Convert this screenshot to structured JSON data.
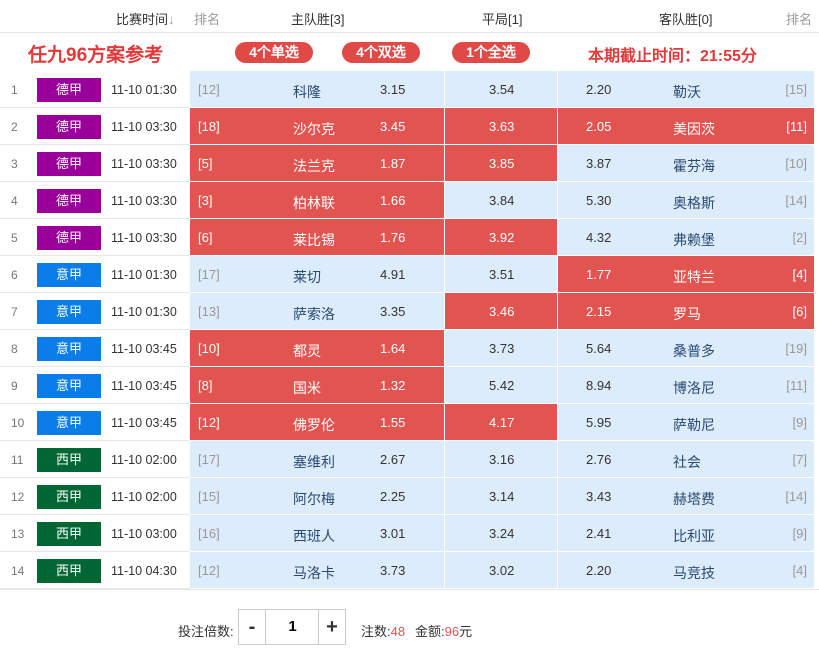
{
  "header": {
    "time_col": "比赛时间",
    "time_sort_icon": "arrow-down-icon",
    "rank_left": "排名",
    "home_win": "主队胜[3]",
    "draw": "平局[1]",
    "away_win": "客队胜[0]",
    "rank_right": "排名"
  },
  "banner": {
    "title": "任九96方案参考",
    "singles": "4个单选",
    "doubles": "4个双选",
    "all": "1个全选",
    "deadline": "本期截止时间：21:55分"
  },
  "colors": {
    "bundesliga": "#990099",
    "serie_a": "#0a7de8",
    "la_liga": "#006633",
    "selected": "#e25450",
    "unselected": "#dcecfa"
  },
  "matches": [
    {
      "no": "1",
      "league": "德甲",
      "lc": "#990099",
      "time": "11-10 01:30",
      "hr": "[12]",
      "home": "科隆",
      "h": "3.15",
      "d": "3.54",
      "a": "2.20",
      "away": "勒沃",
      "ar": "[15]",
      "sh": false,
      "sd": false,
      "sa": false
    },
    {
      "no": "2",
      "league": "德甲",
      "lc": "#990099",
      "time": "11-10 03:30",
      "hr": "[18]",
      "home": "沙尔克",
      "h": "3.45",
      "d": "3.63",
      "a": "2.05",
      "away": "美因茨",
      "ar": "[11]",
      "sh": true,
      "sd": true,
      "sa": true
    },
    {
      "no": "3",
      "league": "德甲",
      "lc": "#990099",
      "time": "11-10 03:30",
      "hr": "[5]",
      "home": "法兰克",
      "h": "1.87",
      "d": "3.85",
      "a": "3.87",
      "away": "霍芬海",
      "ar": "[10]",
      "sh": true,
      "sd": true,
      "sa": false
    },
    {
      "no": "4",
      "league": "德甲",
      "lc": "#990099",
      "time": "11-10 03:30",
      "hr": "[3]",
      "home": "柏林联",
      "h": "1.66",
      "d": "3.84",
      "a": "5.30",
      "away": "奥格斯",
      "ar": "[14]",
      "sh": true,
      "sd": false,
      "sa": false
    },
    {
      "no": "5",
      "league": "德甲",
      "lc": "#990099",
      "time": "11-10 03:30",
      "hr": "[6]",
      "home": "莱比锡",
      "h": "1.76",
      "d": "3.92",
      "a": "4.32",
      "away": "弗赖堡",
      "ar": "[2]",
      "sh": true,
      "sd": true,
      "sa": false
    },
    {
      "no": "6",
      "league": "意甲",
      "lc": "#0a7de8",
      "time": "11-10 01:30",
      "hr": "[17]",
      "home": "莱切",
      "h": "4.91",
      "d": "3.51",
      "a": "1.77",
      "away": "亚特兰",
      "ar": "[4]",
      "sh": false,
      "sd": false,
      "sa": true
    },
    {
      "no": "7",
      "league": "意甲",
      "lc": "#0a7de8",
      "time": "11-10 01:30",
      "hr": "[13]",
      "home": "萨索洛",
      "h": "3.35",
      "d": "3.46",
      "a": "2.15",
      "away": "罗马",
      "ar": "[6]",
      "sh": false,
      "sd": true,
      "sa": true
    },
    {
      "no": "8",
      "league": "意甲",
      "lc": "#0a7de8",
      "time": "11-10 03:45",
      "hr": "[10]",
      "home": "都灵",
      "h": "1.64",
      "d": "3.73",
      "a": "5.64",
      "away": "桑普多",
      "ar": "[19]",
      "sh": true,
      "sd": false,
      "sa": false
    },
    {
      "no": "9",
      "league": "意甲",
      "lc": "#0a7de8",
      "time": "11-10 03:45",
      "hr": "[8]",
      "home": "国米",
      "h": "1.32",
      "d": "5.42",
      "a": "8.94",
      "away": "博洛尼",
      "ar": "[11]",
      "sh": true,
      "sd": false,
      "sa": false
    },
    {
      "no": "10",
      "league": "意甲",
      "lc": "#0a7de8",
      "time": "11-10 03:45",
      "hr": "[12]",
      "home": "佛罗伦",
      "h": "1.55",
      "d": "4.17",
      "a": "5.95",
      "away": "萨勒尼",
      "ar": "[9]",
      "sh": true,
      "sd": true,
      "sa": false
    },
    {
      "no": "11",
      "league": "西甲",
      "lc": "#006633",
      "time": "11-10 02:00",
      "hr": "[17]",
      "home": "塞维利",
      "h": "2.67",
      "d": "3.16",
      "a": "2.76",
      "away": "社会",
      "ar": "[7]",
      "sh": false,
      "sd": false,
      "sa": false
    },
    {
      "no": "12",
      "league": "西甲",
      "lc": "#006633",
      "time": "11-10 02:00",
      "hr": "[15]",
      "home": "阿尔梅",
      "h": "2.25",
      "d": "3.14",
      "a": "3.43",
      "away": "赫塔费",
      "ar": "[14]",
      "sh": false,
      "sd": false,
      "sa": false
    },
    {
      "no": "13",
      "league": "西甲",
      "lc": "#006633",
      "time": "11-10 03:00",
      "hr": "[16]",
      "home": "西班人",
      "h": "3.01",
      "d": "3.24",
      "a": "2.41",
      "away": "比利亚",
      "ar": "[9]",
      "sh": false,
      "sd": false,
      "sa": false
    },
    {
      "no": "14",
      "league": "西甲",
      "lc": "#006633",
      "time": "11-10 04:30",
      "hr": "[12]",
      "home": "马洛卡",
      "h": "3.73",
      "d": "3.02",
      "a": "2.20",
      "away": "马竞技",
      "ar": "[4]",
      "sh": false,
      "sd": false,
      "sa": false
    }
  ],
  "footer": {
    "multiplier_label": "投注倍数:",
    "minus": "-",
    "plus": "+",
    "multiplier_value": "1",
    "bets_label": "注数:",
    "bets_value": "48",
    "amount_label": "金额:",
    "amount_value": "96",
    "amount_unit": "元"
  }
}
